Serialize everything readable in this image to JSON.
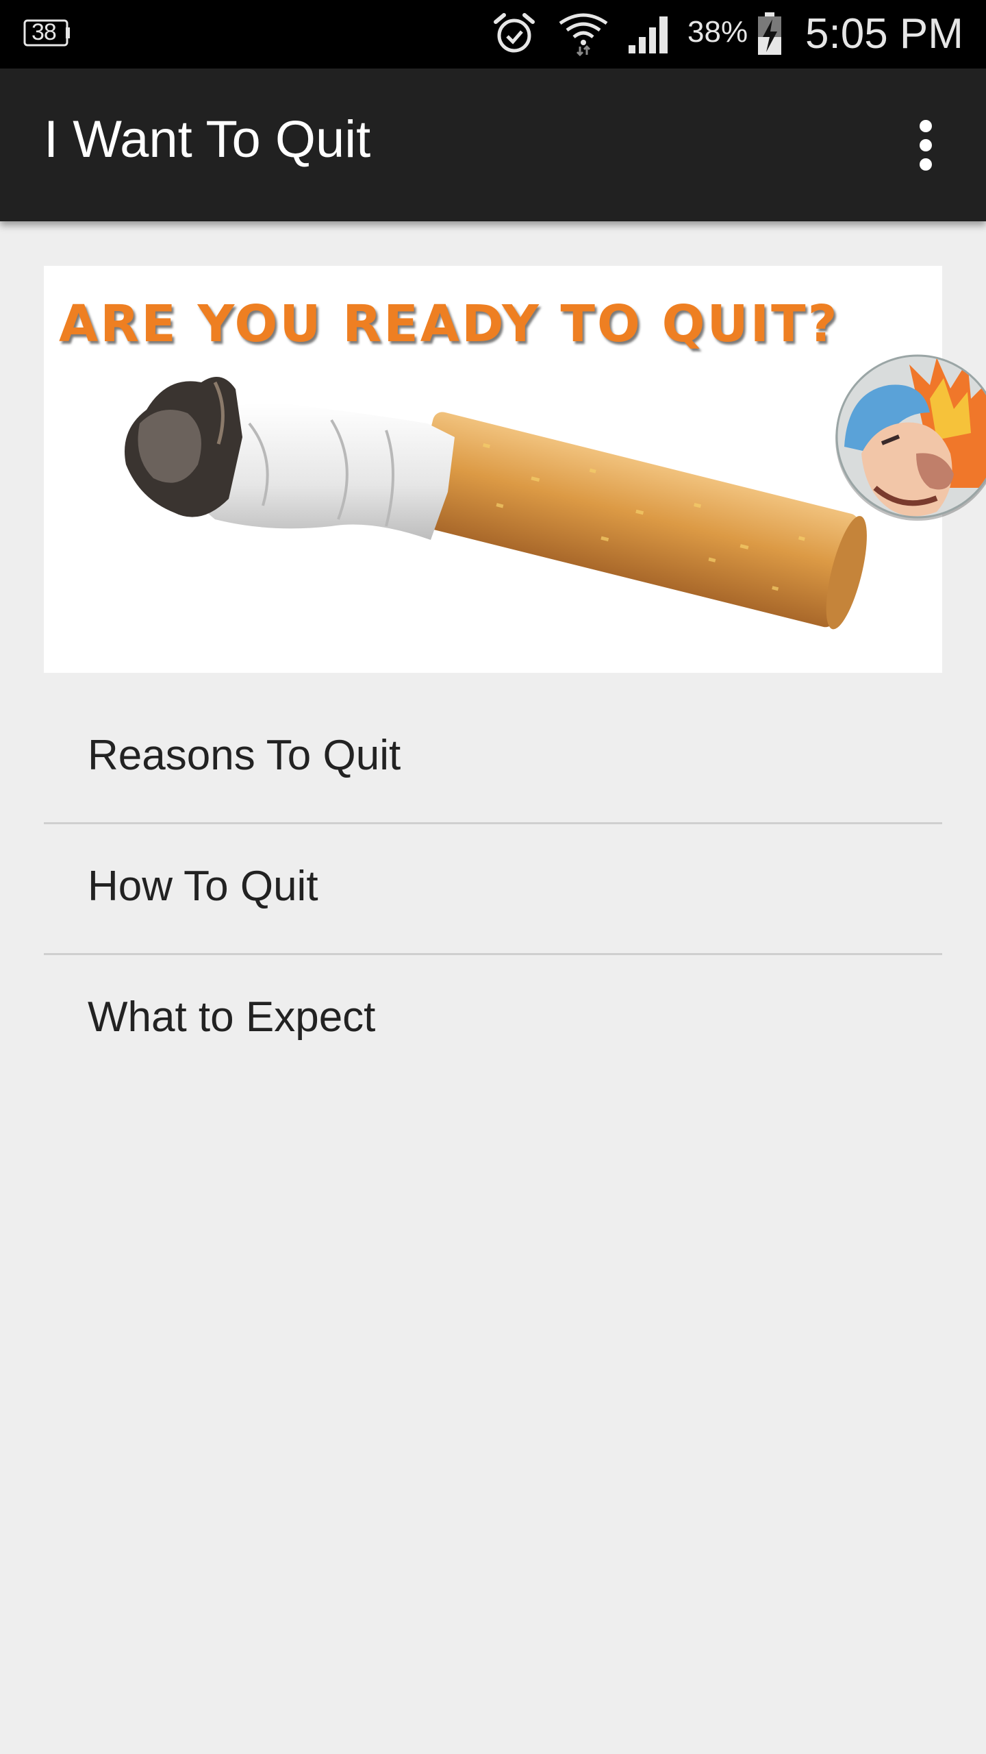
{
  "status_bar": {
    "notification_badge": "38",
    "battery_percent": "38%",
    "time": "5:05 PM",
    "icons": [
      "notification-badge-icon",
      "alarm-icon",
      "wifi-icon",
      "signal-icon",
      "battery-charging-icon"
    ]
  },
  "app_bar": {
    "title": "I Want To Quit",
    "overflow_icon": "more-vert-icon"
  },
  "banner": {
    "headline": "ARE YOU READY TO QUIT?",
    "image": "cigarette-butt-image"
  },
  "menu": {
    "items": [
      {
        "label": "Reasons To Quit"
      },
      {
        "label": "How To Quit"
      },
      {
        "label": "What to Expect"
      }
    ]
  },
  "colors": {
    "status_bar_bg": "#000000",
    "app_bar_bg": "#212121",
    "page_bg": "#eeeeee",
    "headline_orange": "#ee7f22",
    "divider": "#cfcfcf"
  }
}
